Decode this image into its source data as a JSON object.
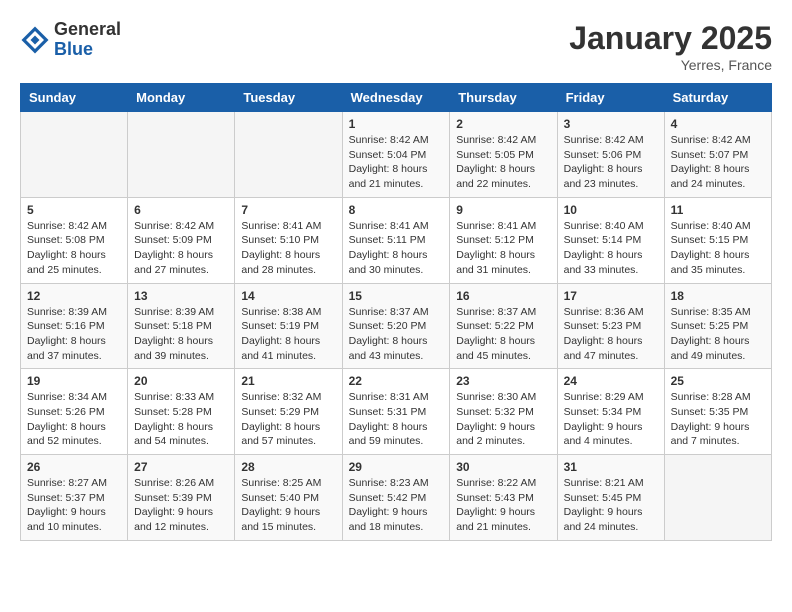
{
  "logo": {
    "general": "General",
    "blue": "Blue"
  },
  "title": "January 2025",
  "location": "Yerres, France",
  "weekdays": [
    "Sunday",
    "Monday",
    "Tuesday",
    "Wednesday",
    "Thursday",
    "Friday",
    "Saturday"
  ],
  "weeks": [
    [
      {
        "day": "",
        "info": ""
      },
      {
        "day": "",
        "info": ""
      },
      {
        "day": "",
        "info": ""
      },
      {
        "day": "1",
        "info": "Sunrise: 8:42 AM\nSunset: 5:04 PM\nDaylight: 8 hours and 21 minutes."
      },
      {
        "day": "2",
        "info": "Sunrise: 8:42 AM\nSunset: 5:05 PM\nDaylight: 8 hours and 22 minutes."
      },
      {
        "day": "3",
        "info": "Sunrise: 8:42 AM\nSunset: 5:06 PM\nDaylight: 8 hours and 23 minutes."
      },
      {
        "day": "4",
        "info": "Sunrise: 8:42 AM\nSunset: 5:07 PM\nDaylight: 8 hours and 24 minutes."
      }
    ],
    [
      {
        "day": "5",
        "info": "Sunrise: 8:42 AM\nSunset: 5:08 PM\nDaylight: 8 hours and 25 minutes."
      },
      {
        "day": "6",
        "info": "Sunrise: 8:42 AM\nSunset: 5:09 PM\nDaylight: 8 hours and 27 minutes."
      },
      {
        "day": "7",
        "info": "Sunrise: 8:41 AM\nSunset: 5:10 PM\nDaylight: 8 hours and 28 minutes."
      },
      {
        "day": "8",
        "info": "Sunrise: 8:41 AM\nSunset: 5:11 PM\nDaylight: 8 hours and 30 minutes."
      },
      {
        "day": "9",
        "info": "Sunrise: 8:41 AM\nSunset: 5:12 PM\nDaylight: 8 hours and 31 minutes."
      },
      {
        "day": "10",
        "info": "Sunrise: 8:40 AM\nSunset: 5:14 PM\nDaylight: 8 hours and 33 minutes."
      },
      {
        "day": "11",
        "info": "Sunrise: 8:40 AM\nSunset: 5:15 PM\nDaylight: 8 hours and 35 minutes."
      }
    ],
    [
      {
        "day": "12",
        "info": "Sunrise: 8:39 AM\nSunset: 5:16 PM\nDaylight: 8 hours and 37 minutes."
      },
      {
        "day": "13",
        "info": "Sunrise: 8:39 AM\nSunset: 5:18 PM\nDaylight: 8 hours and 39 minutes."
      },
      {
        "day": "14",
        "info": "Sunrise: 8:38 AM\nSunset: 5:19 PM\nDaylight: 8 hours and 41 minutes."
      },
      {
        "day": "15",
        "info": "Sunrise: 8:37 AM\nSunset: 5:20 PM\nDaylight: 8 hours and 43 minutes."
      },
      {
        "day": "16",
        "info": "Sunrise: 8:37 AM\nSunset: 5:22 PM\nDaylight: 8 hours and 45 minutes."
      },
      {
        "day": "17",
        "info": "Sunrise: 8:36 AM\nSunset: 5:23 PM\nDaylight: 8 hours and 47 minutes."
      },
      {
        "day": "18",
        "info": "Sunrise: 8:35 AM\nSunset: 5:25 PM\nDaylight: 8 hours and 49 minutes."
      }
    ],
    [
      {
        "day": "19",
        "info": "Sunrise: 8:34 AM\nSunset: 5:26 PM\nDaylight: 8 hours and 52 minutes."
      },
      {
        "day": "20",
        "info": "Sunrise: 8:33 AM\nSunset: 5:28 PM\nDaylight: 8 hours and 54 minutes."
      },
      {
        "day": "21",
        "info": "Sunrise: 8:32 AM\nSunset: 5:29 PM\nDaylight: 8 hours and 57 minutes."
      },
      {
        "day": "22",
        "info": "Sunrise: 8:31 AM\nSunset: 5:31 PM\nDaylight: 8 hours and 59 minutes."
      },
      {
        "day": "23",
        "info": "Sunrise: 8:30 AM\nSunset: 5:32 PM\nDaylight: 9 hours and 2 minutes."
      },
      {
        "day": "24",
        "info": "Sunrise: 8:29 AM\nSunset: 5:34 PM\nDaylight: 9 hours and 4 minutes."
      },
      {
        "day": "25",
        "info": "Sunrise: 8:28 AM\nSunset: 5:35 PM\nDaylight: 9 hours and 7 minutes."
      }
    ],
    [
      {
        "day": "26",
        "info": "Sunrise: 8:27 AM\nSunset: 5:37 PM\nDaylight: 9 hours and 10 minutes."
      },
      {
        "day": "27",
        "info": "Sunrise: 8:26 AM\nSunset: 5:39 PM\nDaylight: 9 hours and 12 minutes."
      },
      {
        "day": "28",
        "info": "Sunrise: 8:25 AM\nSunset: 5:40 PM\nDaylight: 9 hours and 15 minutes."
      },
      {
        "day": "29",
        "info": "Sunrise: 8:23 AM\nSunset: 5:42 PM\nDaylight: 9 hours and 18 minutes."
      },
      {
        "day": "30",
        "info": "Sunrise: 8:22 AM\nSunset: 5:43 PM\nDaylight: 9 hours and 21 minutes."
      },
      {
        "day": "31",
        "info": "Sunrise: 8:21 AM\nSunset: 5:45 PM\nDaylight: 9 hours and 24 minutes."
      },
      {
        "day": "",
        "info": ""
      }
    ]
  ]
}
